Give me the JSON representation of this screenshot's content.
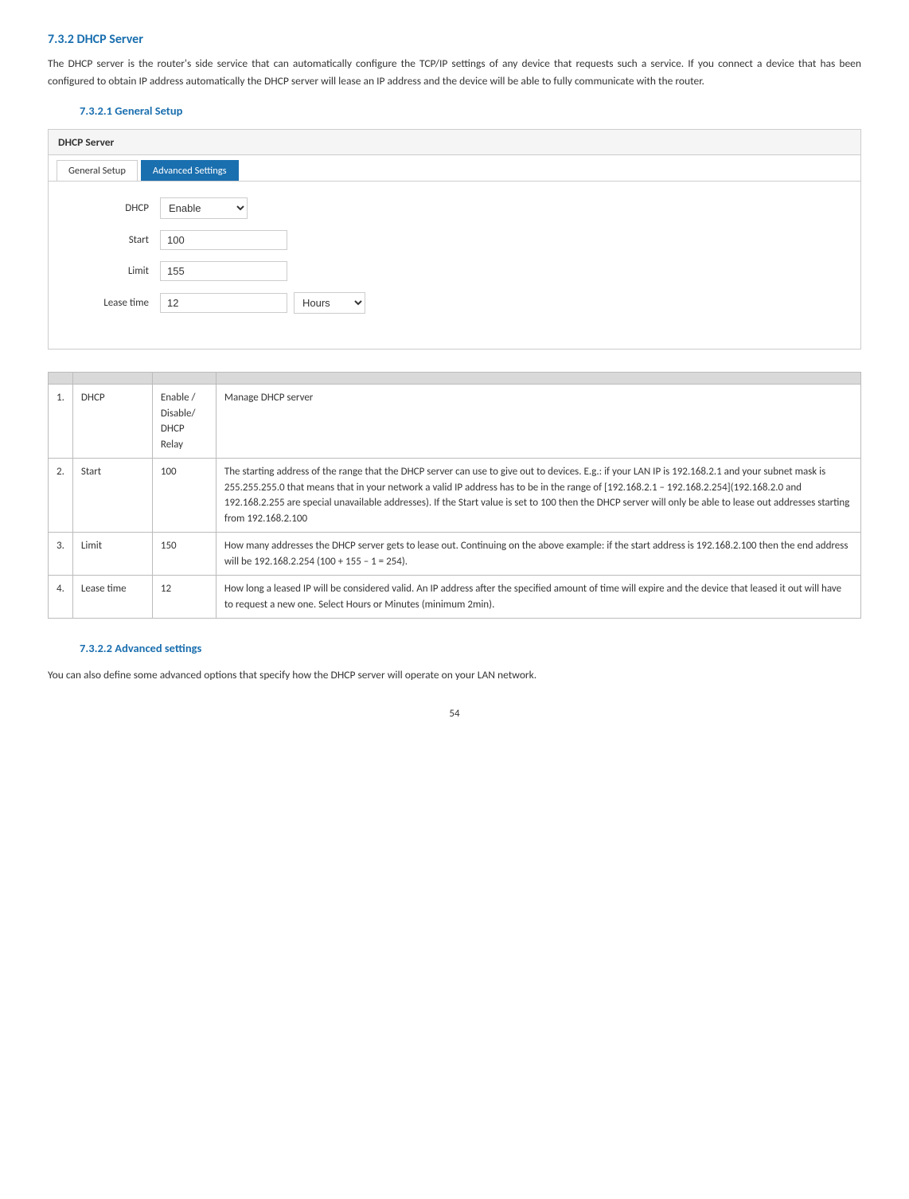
{
  "page": {
    "section_732": {
      "heading": "7.3.2  DHCP Server",
      "intro": "The DHCP server is the router's side service that can automatically configure the TCP/IP settings of any device that requests such a service. If you connect a device that has been configured to obtain IP address automatically the DHCP server will lease an IP address and the device will be able to fully communicate with the router."
    },
    "section_7321": {
      "heading": "7.3.2.1   General Setup"
    },
    "dhcp_box": {
      "header": "DHCP Server",
      "tab_general": "General Setup",
      "tab_advanced": "Advanced Settings",
      "fields": {
        "dhcp_label": "DHCP",
        "dhcp_value": "Enable",
        "dhcp_options": [
          "Enable",
          "Disable",
          "DHCP Relay"
        ],
        "start_label": "Start",
        "start_value": "100",
        "limit_label": "Limit",
        "limit_value": "155",
        "lease_label": "Lease time",
        "lease_value": "12",
        "lease_unit": "Hours",
        "lease_unit_options": [
          "Hours",
          "Minutes"
        ]
      }
    },
    "table": {
      "columns": [
        "",
        "",
        "",
        ""
      ],
      "rows": [
        {
          "num": "1.",
          "field": "DHCP",
          "value": "Enable / Disable/ DHCP Relay",
          "description": "Manage DHCP server"
        },
        {
          "num": "2.",
          "field": "Start",
          "value": "100",
          "description": "The starting address of the range that the DHCP server can use to give out to devices. E.g.: if your LAN IP is 192.168.2.1 and your subnet mask is 255.255.255.0 that means that in your network a valid IP address has to be in the range of [192.168.2.1 – 192.168.2.254](192.168.2.0 and 192.168.2.255 are special unavailable addresses). If the Start value is set to 100 then the DHCP server will only be able to lease out addresses starting from 192.168.2.100"
        },
        {
          "num": "3.",
          "field": "Limit",
          "value": "150",
          "description": "How many addresses the DHCP server gets to lease out. Continuing on the above example: if the start address is 192.168.2.100 then the end address will be 192.168.2.254 (100 + 155 – 1 = 254)."
        },
        {
          "num": "4.",
          "field": "Lease time",
          "value": "12",
          "description": "How long a leased IP will be considered valid. An IP address after the specified amount of time will expire and the device that leased it out will have to request a new one. Select Hours or Minutes (minimum 2min)."
        }
      ]
    },
    "section_7322": {
      "heading": "7.3.2.2   Advanced settings",
      "intro": "You can also define some advanced options that specify how the DHCP server will operate on your LAN network."
    },
    "page_number": "54"
  }
}
